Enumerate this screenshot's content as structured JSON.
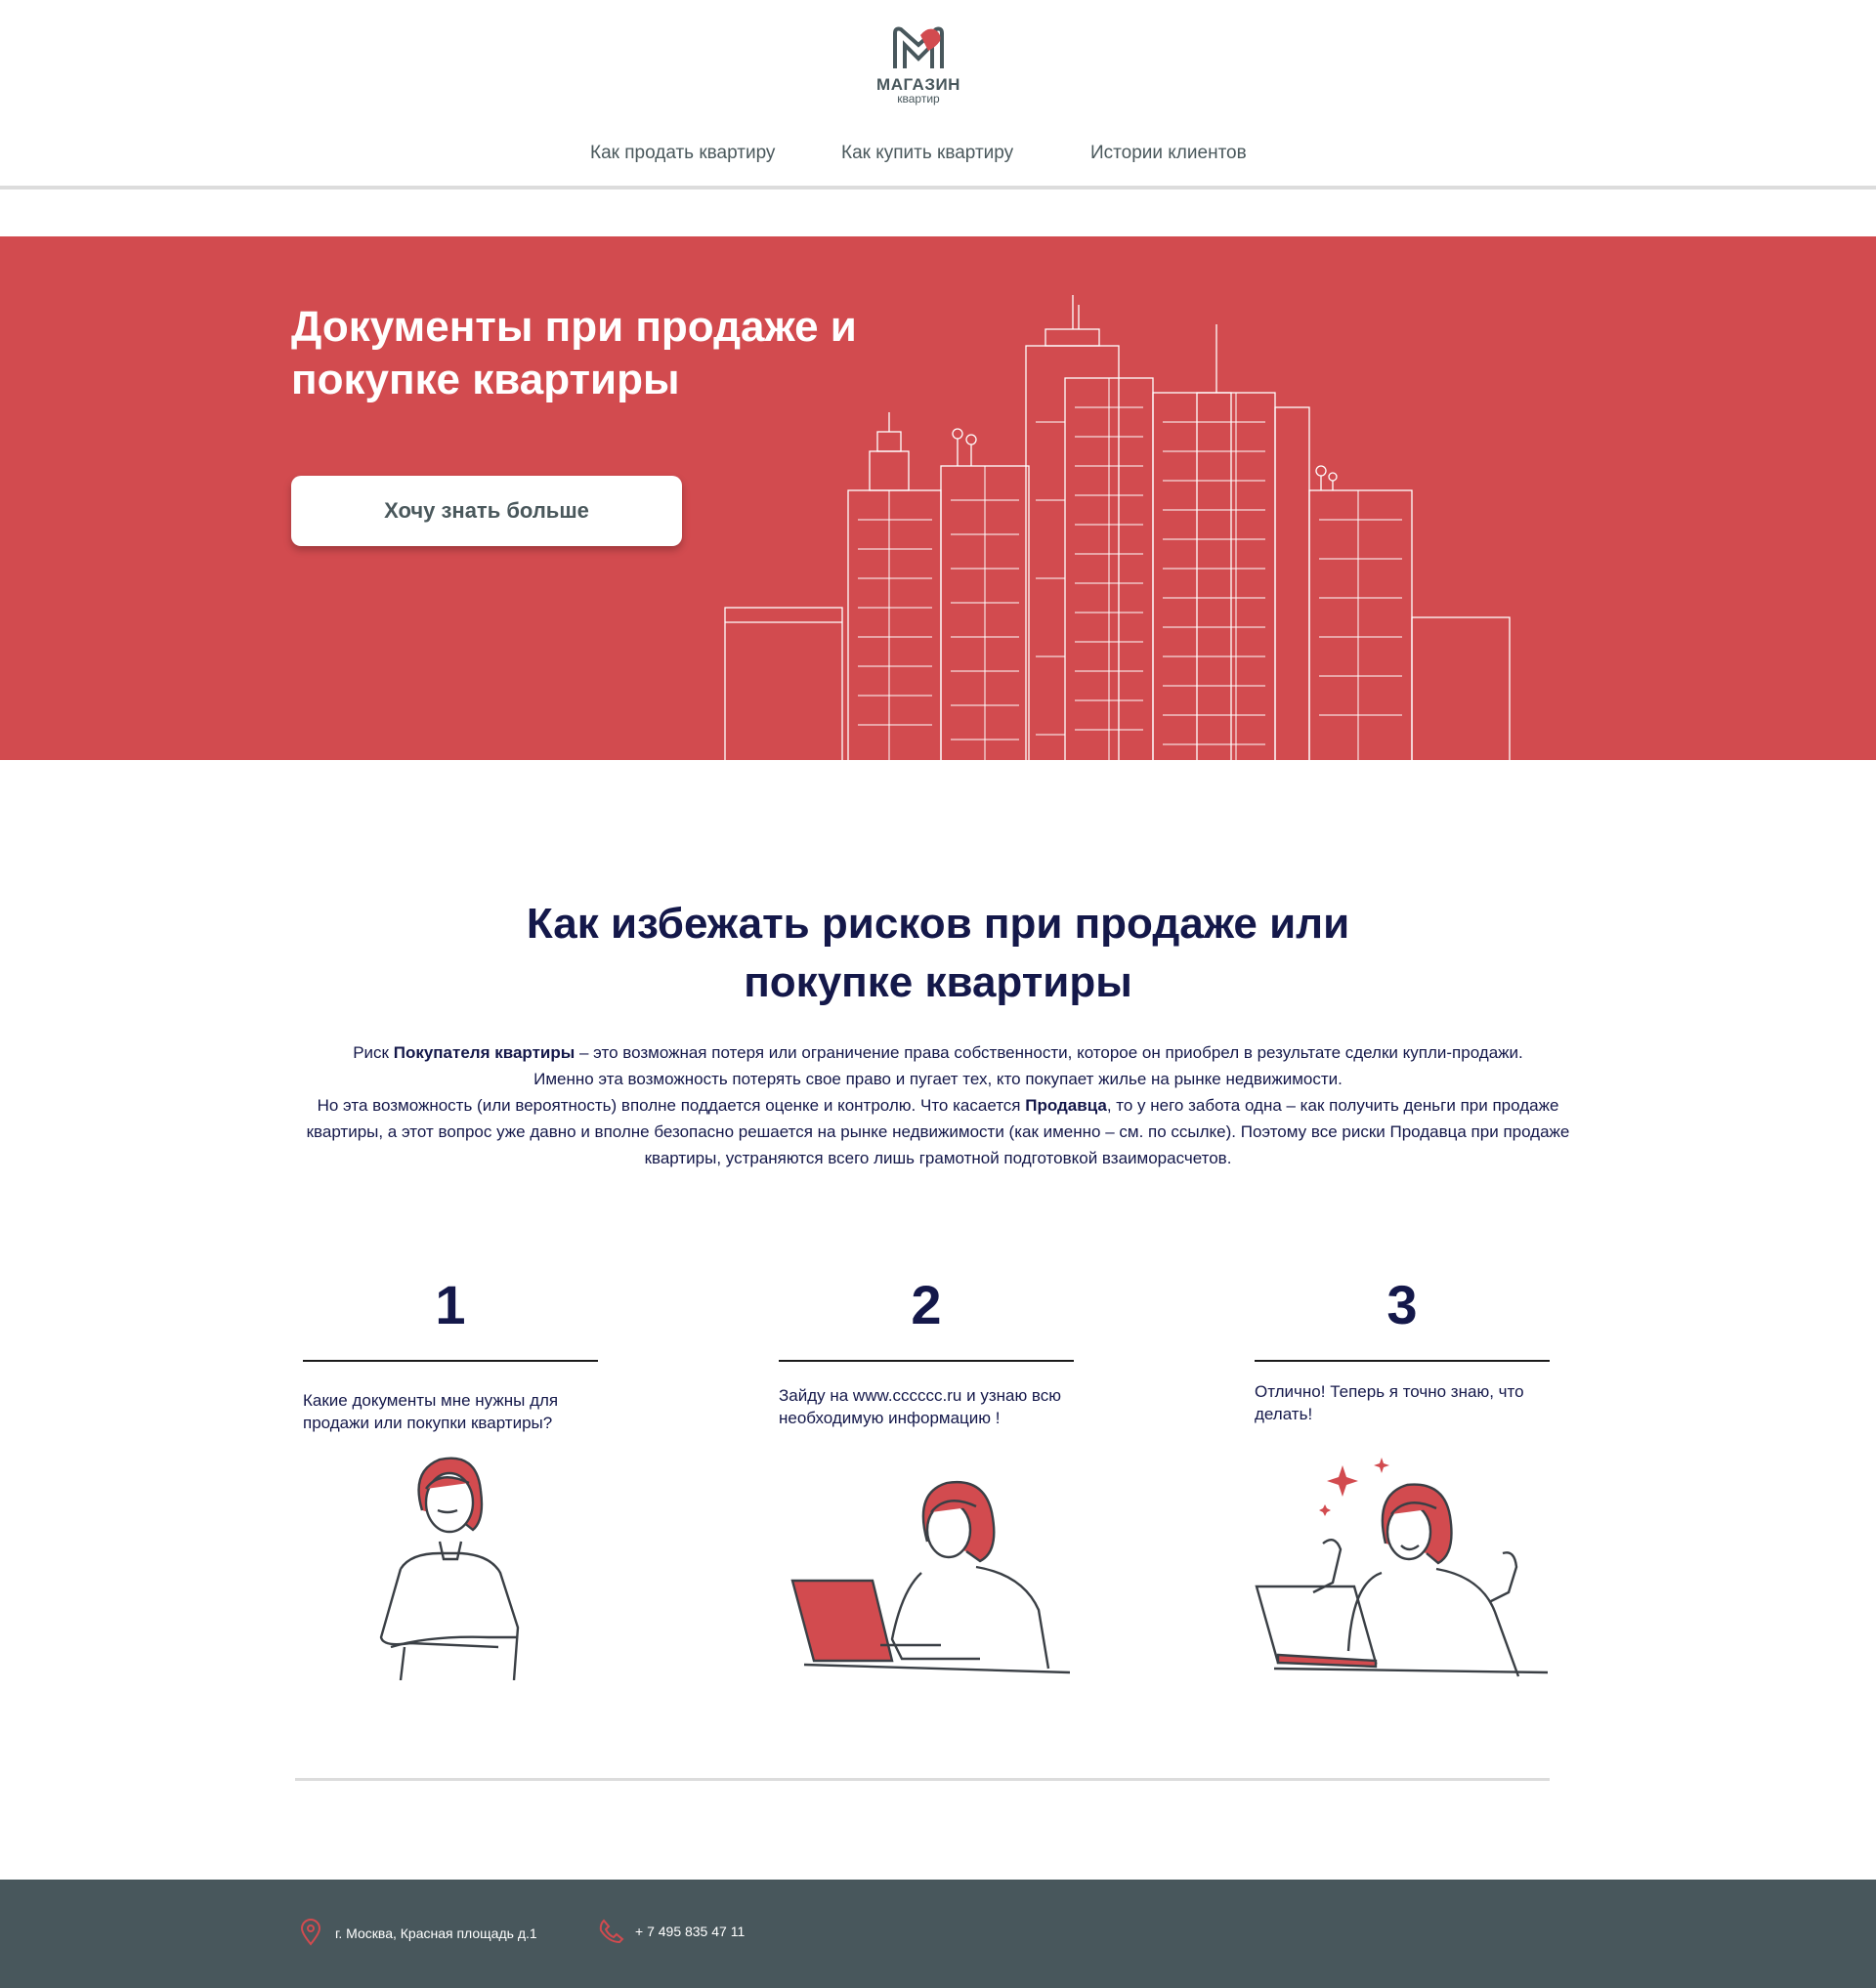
{
  "brand": {
    "name": "МАГАЗИН",
    "sub": "квартир",
    "colors": {
      "accent": "#d24b4f",
      "dark": "#48575c",
      "navy": "#14184a"
    }
  },
  "nav": {
    "items": [
      {
        "label": "Как продать квартиру"
      },
      {
        "label": "Как купить квартиру"
      },
      {
        "label": "Истории клиентов"
      }
    ]
  },
  "hero": {
    "title_line1": "Документы при  продаже и",
    "title_line2": "покупке квартиры",
    "button_label": "Хочу знать больше"
  },
  "risks": {
    "title_line1": "Как  избежать рисков  при продаже или",
    "title_line2": "покупке квартиры",
    "p1_pre": "Риск ",
    "p1_bold": "Покупателя квартиры",
    "p1_post": " – это возможная потеря или ограничение права собственности,  которое он приобрел в результате сделки купли-продажи.",
    "p2": "Именно эта возможность потерять свое право и пугает тех, кто покупает жилье на рынке недвижимости.",
    "p3_pre": "Но эта возможность (или вероятность) вполне поддается оценке и контролю.  Что касается ",
    "p3_bold": "Продавца",
    "p3_post": ", то у него забота одна – как получить деньги при продаже квартиры, а этот вопрос уже давно и вполне безопасно решается на рынке недвижимости (как именно – см. по ссылке). Поэтому все риски Продавца при продаже квартиры, устраняются всего лишь грамотной подготовкой взаиморасчетов."
  },
  "steps": [
    {
      "number": "1",
      "text": "Какие документы мне нужны для продажи или покупки квартиры?"
    },
    {
      "number": "2",
      "text": "Зайду на www.cccccc.ru и узнаю всю необходимую информацию !"
    },
    {
      "number": "3",
      "text": "Отлично! Теперь я точно знаю, что делать!"
    }
  ],
  "footer": {
    "address": "г. Москва, Красная площадь д.1",
    "phone": "+ 7 495 835 47 11",
    "address_icon": "location-pin-icon",
    "phone_icon": "phone-icon"
  }
}
